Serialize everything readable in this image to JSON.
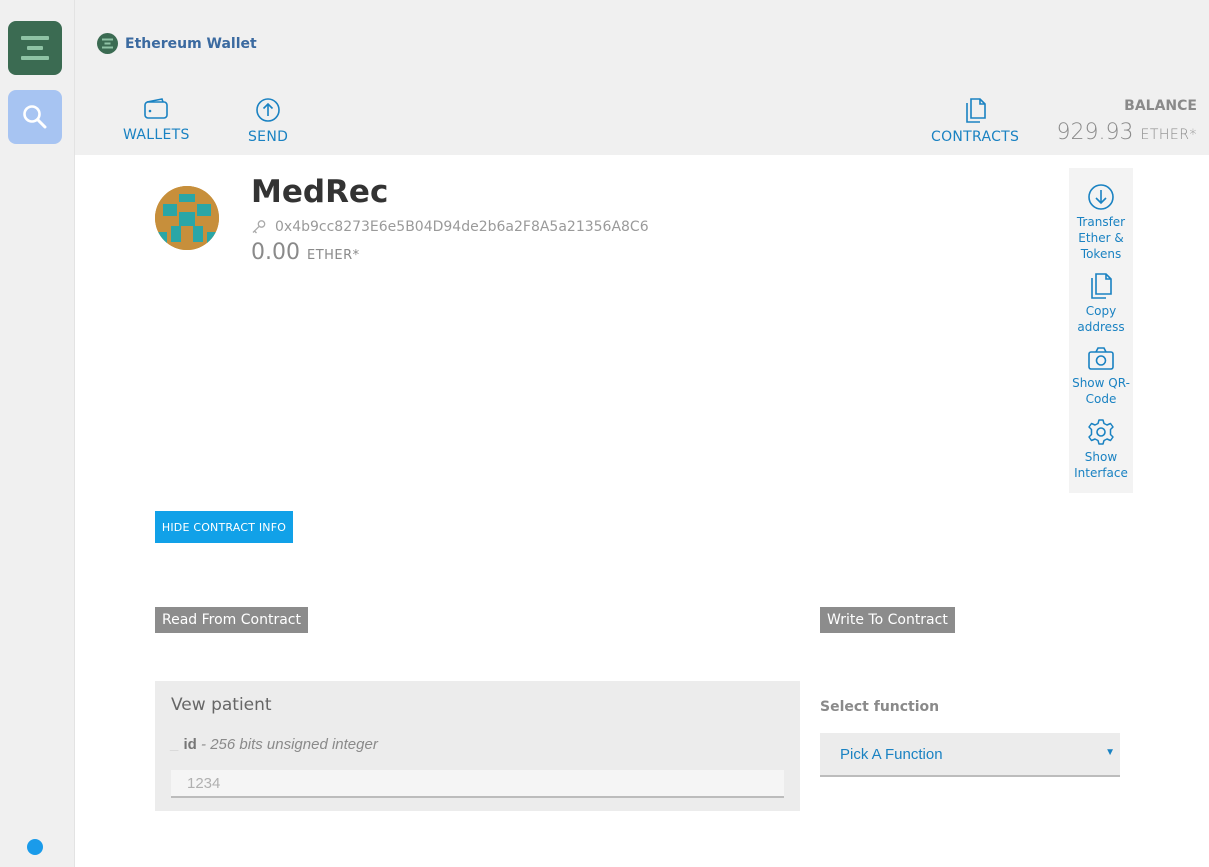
{
  "app": {
    "brand": "Ethereum Wallet"
  },
  "nav": {
    "wallets": "WALLETS",
    "send": "SEND",
    "contracts": "CONTRACTS"
  },
  "balance": {
    "label": "BALANCE",
    "value": "929.93",
    "unit": "ETHER*"
  },
  "contract": {
    "name": "MedRec",
    "address": "0x4b9cc8273E6e5B04D94de2b6a2F8A5a21356A8C6",
    "balance": "0.00",
    "unit": "ETHER*"
  },
  "actions": {
    "transfer": "Transfer Ether & Tokens",
    "copy": "Copy address",
    "qr": "Show QR-Code",
    "interface": "Show Interface"
  },
  "hide_button": "HIDE CONTRACT INFO",
  "read": {
    "tag": "Read From Contract",
    "function_title": "Vew patient",
    "param_name": "id",
    "param_type": "- 256 bits unsigned integer",
    "placeholder": "1234"
  },
  "write": {
    "tag": "Write To Contract",
    "select_label": "Select function",
    "selected": "Pick A Function"
  },
  "colors": {
    "accent": "#1a82c2",
    "button": "#11a1e8",
    "sidebar_green": "#3b6b52"
  }
}
